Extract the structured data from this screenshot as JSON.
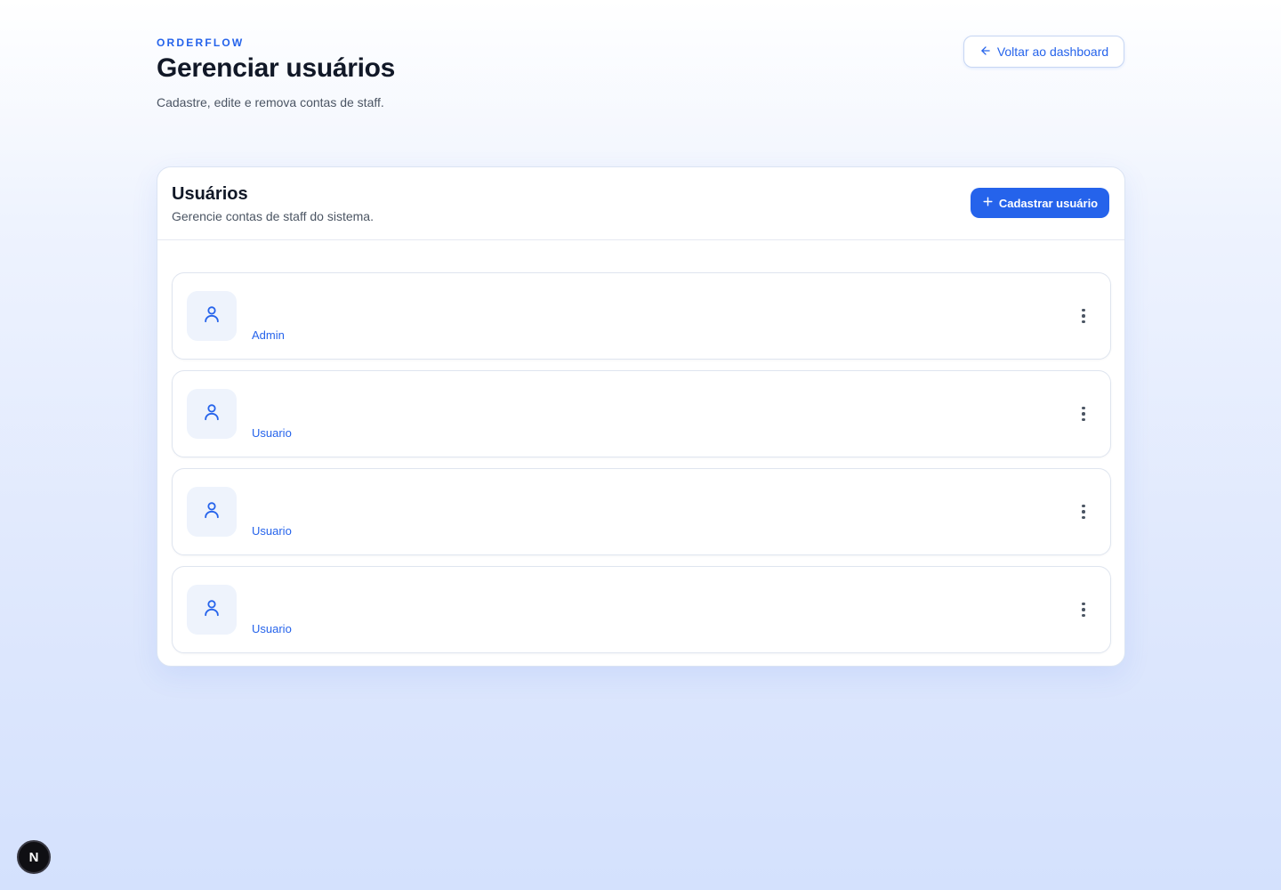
{
  "header": {
    "brand": "ORDERFLOW",
    "title": "Gerenciar usuários",
    "subtitle": "Cadastre, edite e remova contas de staff.",
    "back_button": {
      "label": "Voltar ao dashboard",
      "icon": "arrow-left-icon"
    }
  },
  "users_card": {
    "title": "Usuários",
    "subtitle": "Gerencie contas de staff do sistema.",
    "add_button": {
      "label": "Cadastrar usuário",
      "icon": "plus-icon"
    },
    "users": [
      {
        "name": "",
        "role": "Admin"
      },
      {
        "name": "",
        "role": "Usuario"
      },
      {
        "name": "",
        "role": "Usuario"
      },
      {
        "name": "",
        "role": "Usuario"
      }
    ]
  },
  "dev_badge": {
    "label": "N"
  },
  "colors": {
    "accent": "#2563eb",
    "title_text": "#111827",
    "muted_text": "#4b5563",
    "avatar_bg": "#eef3fc"
  }
}
